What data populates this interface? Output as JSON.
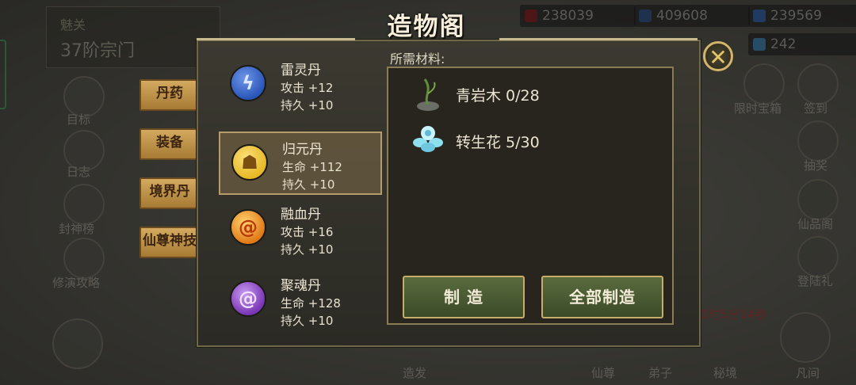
{
  "background": {
    "realm_label": "魅关",
    "rank": "37阶宗门",
    "resources": [
      "238039",
      "409608",
      "239569",
      "242"
    ],
    "left_labels": [
      "目标",
      "日志",
      "封神榜",
      "修演攻略"
    ],
    "right_labels": [
      "限时宝箱",
      "签到",
      "抽奖",
      "仙品阁",
      "登陆礼"
    ],
    "bottom_labels": [
      "造发",
      "仙尊",
      "弟子",
      "秘境",
      "凡间"
    ],
    "timer": "1时5分14秒"
  },
  "side_tabs": [
    "丹药",
    "装备",
    "境界丹",
    "仙尊神技"
  ],
  "dialog": {
    "title": "造物阁",
    "close_icon": "close-icon",
    "items": [
      {
        "name": "雷灵丹",
        "stat1": "攻击 +12",
        "stat2": "持久 +10",
        "color": "#2a56b8"
      },
      {
        "name": "归元丹",
        "stat1": "生命 +112",
        "stat2": "持久 +10",
        "color": "#e8b825"
      },
      {
        "name": "融血丹",
        "stat1": "攻击 +16",
        "stat2": "持久 +10",
        "color": "#e07a17"
      },
      {
        "name": "聚魂丹",
        "stat1": "生命 +128",
        "stat2": "持久 +10",
        "color": "#7a36b5"
      }
    ],
    "selected_index": 1,
    "materials_label": "所需材料:",
    "materials": [
      {
        "name": "青岩木 0/28",
        "icon": "herb-icon"
      },
      {
        "name": "转生花 5/30",
        "icon": "flower-icon"
      }
    ],
    "craft_button": "制 造",
    "craft_all_button": "全部制造"
  }
}
